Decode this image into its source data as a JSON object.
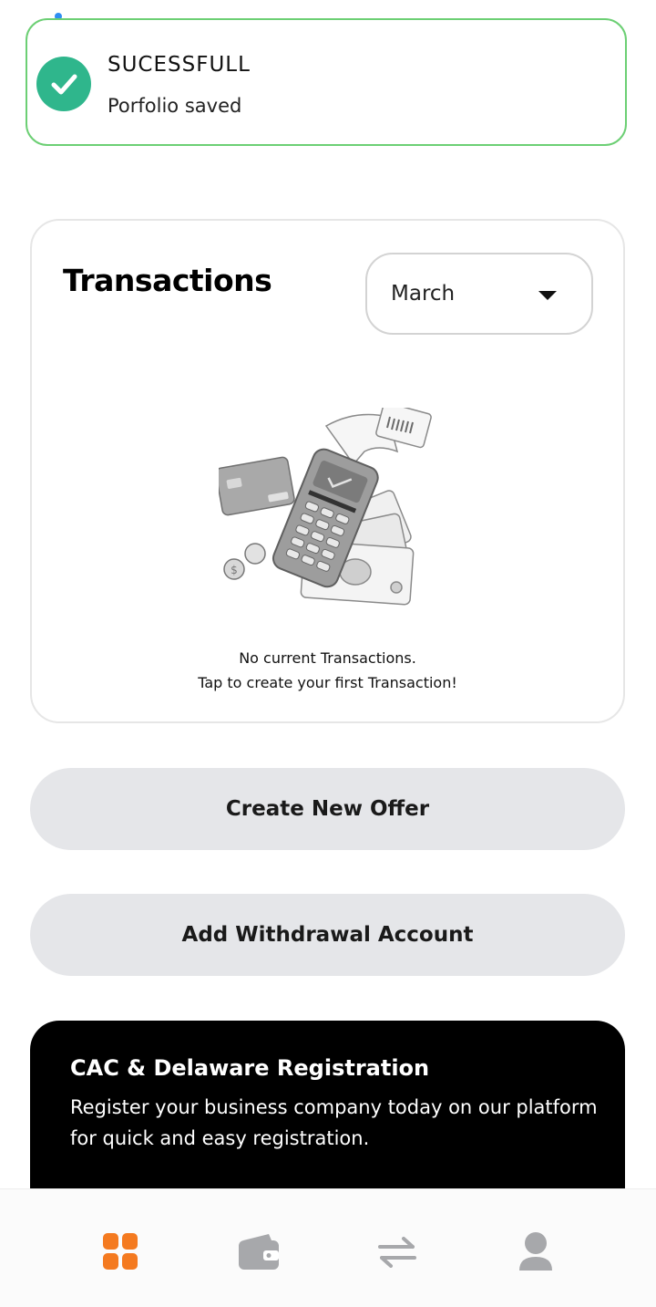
{
  "toast": {
    "title": "SUCESSFULL",
    "message": "Porfolio saved",
    "icon": "check-circle-icon",
    "accent": "#2fb68c",
    "border": "#6ccf74"
  },
  "transactions": {
    "title": "Transactions",
    "month_selected": "March",
    "empty_line1": "No current Transactions.",
    "empty_line2": "Tap to create your first Transaction!"
  },
  "actions": {
    "create_offer": "Create New Offer",
    "add_withdrawal": "Add Withdrawal Account"
  },
  "promo": {
    "title": "CAC & Delaware Registration",
    "text": "Register your business company today on our platform for quick and easy registration."
  },
  "bottom_nav": {
    "items": [
      {
        "icon": "dashboard-icon",
        "active": true,
        "color": "#f47a20"
      },
      {
        "icon": "wallet-icon",
        "active": false,
        "color": "#a7a8ab"
      },
      {
        "icon": "transfer-icon",
        "active": false,
        "color": "#a7a8ab"
      },
      {
        "icon": "profile-icon",
        "active": false,
        "color": "#a7a8ab"
      }
    ]
  }
}
